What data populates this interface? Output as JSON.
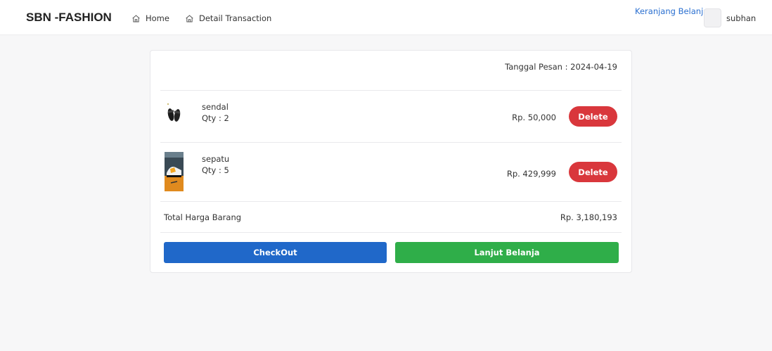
{
  "navbar": {
    "brand": "SBN -FASHION",
    "links": [
      {
        "label": "Home",
        "icon": "home-icon"
      },
      {
        "label": "Detail Transaction",
        "icon": "home-icon"
      }
    ],
    "cart_label": "Keranjang Belanja",
    "username": "subhan"
  },
  "order": {
    "date_text": "Tanggal Pesan : 2024-04-19",
    "items": [
      {
        "name": "sendal",
        "qty": "Qty : 2",
        "price": "Rp. 50,000",
        "delete_label": "Delete",
        "thumb": "sandal-thumbnail"
      },
      {
        "name": "sepatu",
        "qty": "Qty : 5",
        "price": "Rp. 429,999",
        "delete_label": "Delete",
        "thumb": "shoe-box-thumbnail"
      }
    ],
    "total_label": "Total Harga Barang",
    "total_value": "Rp. 3,180,193"
  },
  "actions": {
    "checkout_label": "CheckOut",
    "continue_label": "Lanjut Belanja"
  },
  "colors": {
    "primary": "#2068c9",
    "success": "#2fae49",
    "danger": "#d9373c",
    "link": "#2a6fd0"
  }
}
